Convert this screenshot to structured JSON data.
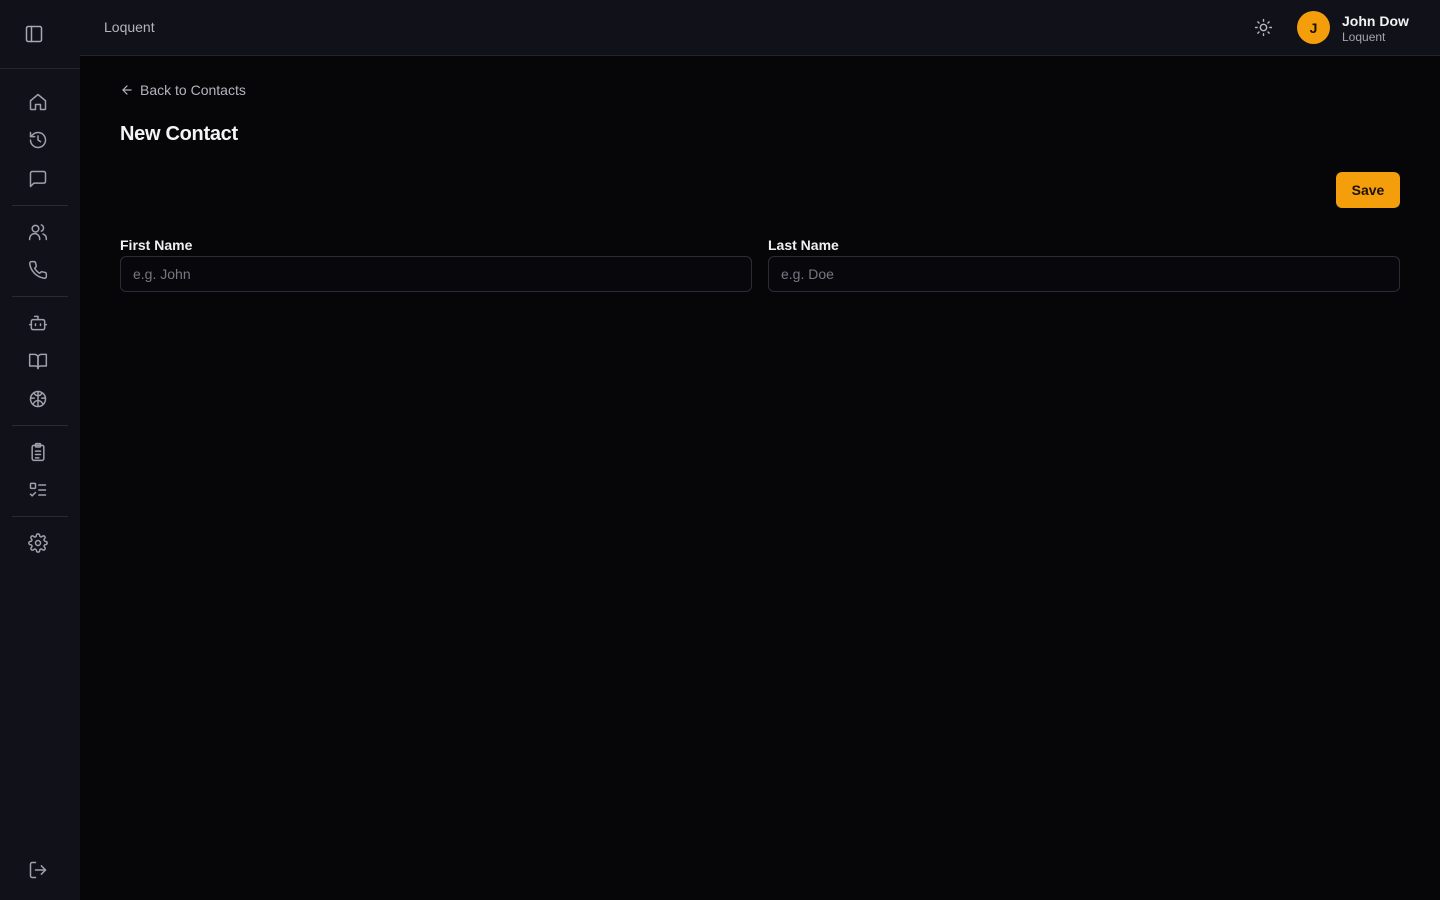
{
  "header": {
    "brand": "Loquent",
    "user": {
      "initial": "J",
      "name": "John Dow",
      "org": "Loquent"
    }
  },
  "sidebar": {
    "items": [
      {
        "icon": "home-icon"
      },
      {
        "icon": "history-icon"
      },
      {
        "icon": "message-icon"
      },
      {
        "icon": "users-icon"
      },
      {
        "icon": "phone-icon"
      },
      {
        "icon": "bot-icon"
      },
      {
        "icon": "book-icon"
      },
      {
        "icon": "brain-icon"
      },
      {
        "icon": "clipboard-icon"
      },
      {
        "icon": "checklist-icon"
      },
      {
        "icon": "gear-icon"
      }
    ],
    "footer": {
      "icon": "logout-icon"
    }
  },
  "main": {
    "back_label": "Back to Contacts",
    "title": "New Contact",
    "save_label": "Save",
    "fields": {
      "first_name": {
        "label": "First Name",
        "value": "",
        "placeholder": "e.g. John"
      },
      "last_name": {
        "label": "Last Name",
        "value": "",
        "placeholder": "e.g. Doe"
      }
    }
  },
  "colors": {
    "accent": "#f59e0b",
    "background": "#060609",
    "sidebar": "#111119"
  }
}
